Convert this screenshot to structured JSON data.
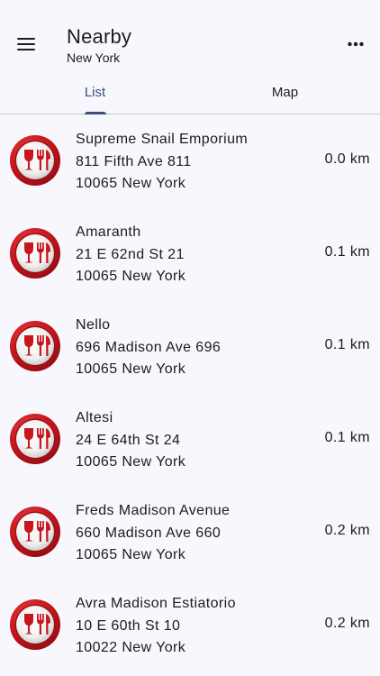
{
  "header": {
    "title": "Nearby",
    "subtitle": "New York",
    "menu_icon": "hamburger-menu-icon",
    "more_icon": "more-dots-icon"
  },
  "tabs": [
    {
      "label": "List",
      "active": true
    },
    {
      "label": "Map",
      "active": false
    }
  ],
  "colors": {
    "accent": "#3c4e7a",
    "icon_red": "#c8161d",
    "background": "#f8f7fd"
  },
  "places": [
    {
      "name": "Supreme Snail Emporium",
      "street": "811 Fifth Ave 811",
      "city": "10065 New York",
      "distance": "0.0 km"
    },
    {
      "name": "Amaranth",
      "street": "21 E 62nd St 21",
      "city": "10065 New York",
      "distance": "0.1 km"
    },
    {
      "name": "Nello",
      "street": "696 Madison Ave 696",
      "city": "10065 New York",
      "distance": "0.1 km"
    },
    {
      "name": "Altesi",
      "street": "24 E 64th St 24",
      "city": "10065 New York",
      "distance": "0.1 km"
    },
    {
      "name": "Freds Madison Avenue",
      "street": "660 Madison Ave 660",
      "city": "10065 New York",
      "distance": "0.2 km"
    },
    {
      "name": "Avra Madison Estiatorio",
      "street": "10 E 60th St 10",
      "city": "10022 New York",
      "distance": "0.2 km"
    }
  ]
}
